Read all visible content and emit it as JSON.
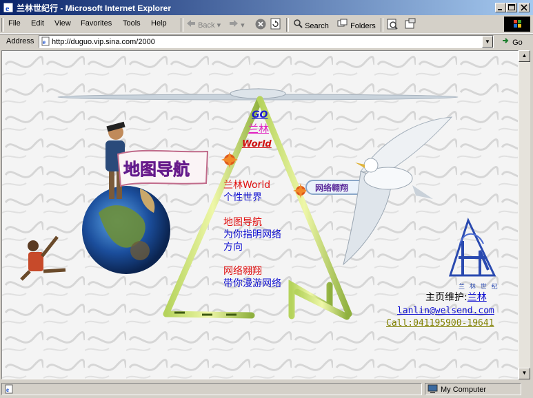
{
  "window": {
    "title": "兰林世纪行 - Microsoft Internet Explorer"
  },
  "menu": [
    {
      "label": "File",
      "key": "F"
    },
    {
      "label": "Edit",
      "key": "E"
    },
    {
      "label": "View",
      "key": "V"
    },
    {
      "label": "Favorites",
      "key": "a"
    },
    {
      "label": "Tools",
      "key": "T"
    },
    {
      "label": "Help",
      "key": "H"
    }
  ],
  "toolbar": {
    "back": "Back",
    "search": "Search",
    "folders": "Folders"
  },
  "address": {
    "label": "Address",
    "url": "http://duguo.vip.sina.com/2000",
    "go": "Go"
  },
  "page": {
    "nav_go": "GO",
    "nav_lanlin": "兰林",
    "nav_world": "World",
    "banner_ditu": "地图导航",
    "banner_wangluo": "网络翱翔",
    "sections": [
      {
        "title": "兰林World",
        "lines": [
          "个性世界"
        ]
      },
      {
        "title": "地图导航",
        "lines": [
          "为你指明网络",
          "方向"
        ]
      },
      {
        "title": "网络翱翔",
        "lines": [
          "带你漫游网络"
        ]
      }
    ],
    "logo_caption": "兰 林 世 纪",
    "maintainer_label": "主页维护:",
    "maintainer_name": "兰林",
    "email": "lanlin@welsend.com",
    "call": "Call:041195900-19641"
  },
  "status": {
    "zone": "My Computer"
  },
  "colors": {
    "title_start": "#0a246a",
    "title_end": "#a6caf0",
    "section_title": "#e01010",
    "section_text": "#1010d0",
    "call_color": "#808000"
  }
}
